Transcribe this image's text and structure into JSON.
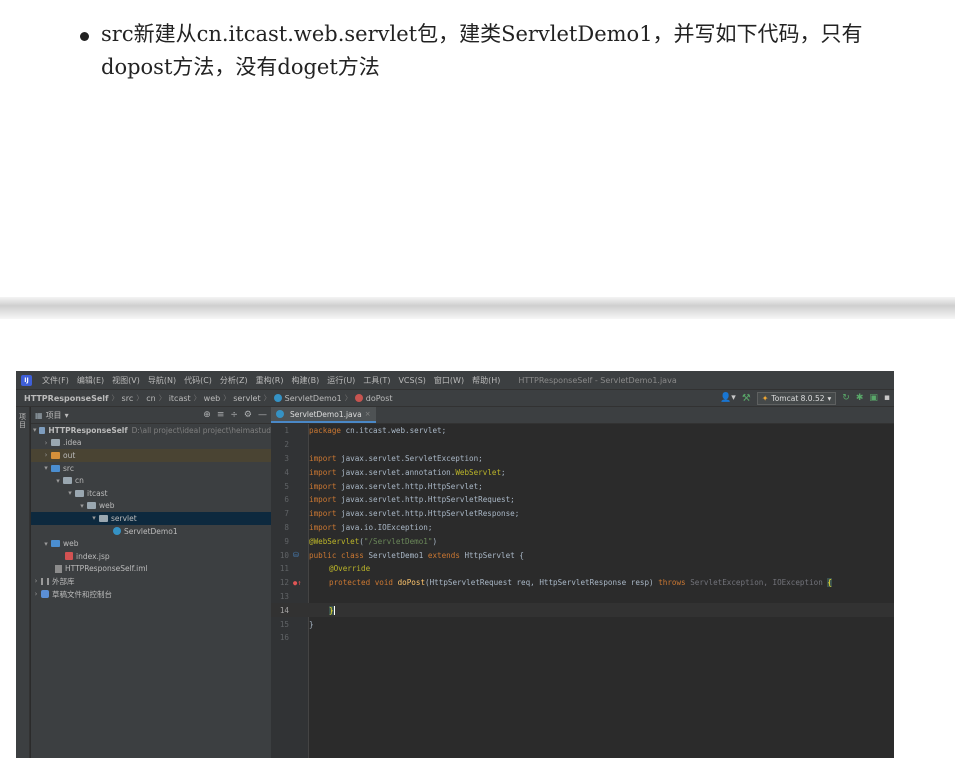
{
  "doc": {
    "line1": "src新建从cn.itcast.web.servlet包，建类ServletDemo1，并写如下代码，只有",
    "line2": "dopost方法，没有doget方法"
  },
  "ide": {
    "menu": [
      "文件(F)",
      "编辑(E)",
      "视图(V)",
      "导航(N)",
      "代码(C)",
      "分析(Z)",
      "重构(R)",
      "构建(B)",
      "运行(U)",
      "工具(T)",
      "VCS(S)",
      "窗口(W)",
      "帮助(H)"
    ],
    "window_title": "HTTPResponseSelf - ServletDemo1.java",
    "breadcrumbs": {
      "project": "HTTPResponseSelf",
      "src": "src",
      "cn": "cn",
      "itcast": "itcast",
      "web": "web",
      "servlet": "servlet",
      "class": "ServletDemo1",
      "method": "doPost"
    },
    "run_config": "Tomcat 8.0.52",
    "side_tab": "项目",
    "project_panel": {
      "title": "项目",
      "root_name": "HTTPResponseSelf",
      "root_path": "D:\\all project\\ideal project\\heimastud",
      "idea": ".idea",
      "out": "out",
      "src": "src",
      "cn": "cn",
      "itcast": "itcast",
      "web_pkg": "web",
      "servlet": "servlet",
      "servlet_demo": "ServletDemo1",
      "web_dir": "web",
      "index": "index.jsp",
      "iml": "HTTPResponseSelf.iml",
      "libs": "外部库",
      "scratches": "草稿文件和控制台"
    },
    "editor_tab": "ServletDemo1.java",
    "line_numbers": [
      "1",
      "2",
      "3",
      "4",
      "5",
      "6",
      "7",
      "8",
      "9",
      "10",
      "11",
      "12",
      "13",
      "14",
      "15",
      "16"
    ],
    "code": {
      "l1_kw": "package",
      "l1_rest": " cn.itcast.web.servlet;",
      "import_kw": "import",
      "l3": " javax.servlet.ServletException;",
      "l4a": " javax.servlet.annotation.",
      "l4b": "WebServlet",
      "l4c": ";",
      "l5": " javax.servlet.http.HttpServlet;",
      "l6": " javax.servlet.http.HttpServletRequest;",
      "l7": " javax.servlet.http.HttpServletResponse;",
      "l8": " java.io.IOException;",
      "l9a": "@WebServlet",
      "l9b": "(",
      "l9c": "\"/ServletDemo1\"",
      "l9d": ")",
      "l10a": "public class",
      "l10b": " ServletDemo1  ",
      "l10c": "extends",
      "l10d": " HttpServlet {",
      "l11": "@Override",
      "l12a": "protected void",
      "l12b": " doPost",
      "l12c": "(HttpServletRequest req, HttpServletResponse resp) ",
      "l12d": "throws",
      "l12e": " ServletException, IOException ",
      "l12f": "{",
      "l14": "}",
      "l15": "}"
    }
  }
}
